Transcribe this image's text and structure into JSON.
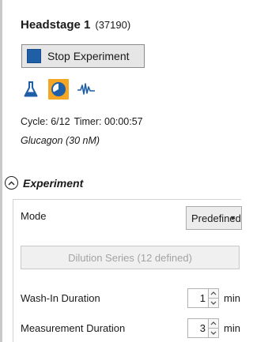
{
  "headstage": {
    "title": "Headstage 1",
    "serial": "(37190)"
  },
  "stop_button": {
    "label": "Stop Experiment",
    "icon": "stop-square-icon",
    "color": "#1f5fa8"
  },
  "view_icons": [
    {
      "name": "flask-icon",
      "selected": false
    },
    {
      "name": "timer-pie-icon",
      "selected": true,
      "accent": "#f5a623"
    },
    {
      "name": "waveform-icon",
      "selected": false
    }
  ],
  "status": {
    "cycle": "Cycle: 6/12",
    "timer": "Timer: 00:00:57",
    "compound": "Glucagon (30 nM)"
  },
  "experiment": {
    "section_title": "Experiment",
    "mode_label": "Mode",
    "mode_value": "Predefined",
    "dilution_button": "Dilution Series (12 defined)",
    "wash_in_label": "Wash-In Duration",
    "wash_in_value": "1",
    "wash_in_unit": "min",
    "measurement_label": "Measurement Duration",
    "measurement_value": "3",
    "measurement_unit": "min"
  }
}
